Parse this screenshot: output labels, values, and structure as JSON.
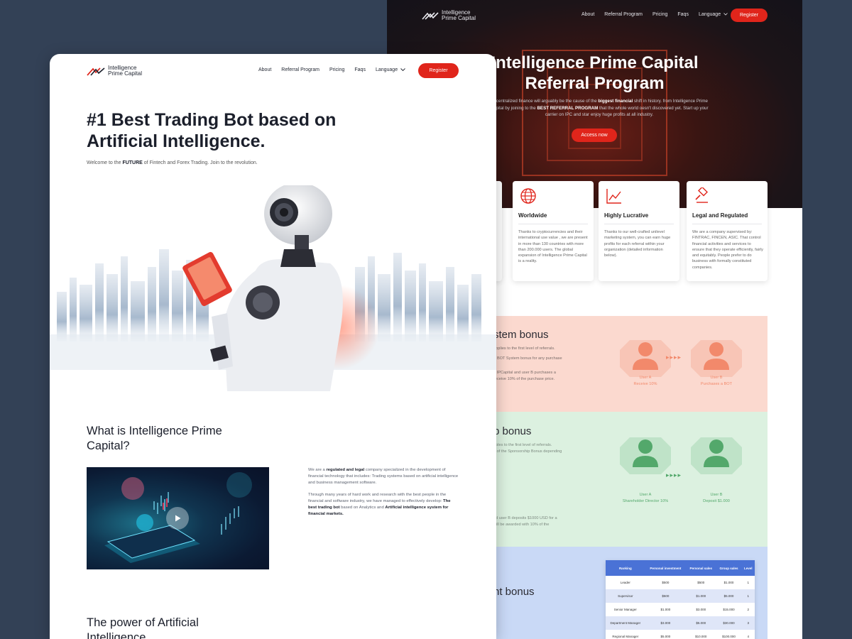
{
  "brand": {
    "line1": "Intelligence",
    "line2": "Prime Capital",
    "accent": "#e0251b"
  },
  "nav": {
    "items": [
      "About",
      "Referral Program",
      "Pricing",
      "Faqs",
      "Language"
    ],
    "register": "Register"
  },
  "referral_page": {
    "title": "Intelligence Prime Capital\nReferral Program",
    "intro_parts": [
      "Decentralized finance will arguably be the cause of the ",
      "biggest financial",
      " shift in history. from Intelligence Prime Capital by joining to the ",
      "BEST REFERRAL PROGRAM",
      " that the whole world oesn't discovered yet. Start up your carrier on IPC and star enjoy huge profits at all industry."
    ],
    "cta": "Access now",
    "cards": [
      {
        "icon": "globe-icon",
        "title": "Worldwide",
        "text": "Thanks to cryptocurrencies and their international use value , we are present in more than 130 countries with more than 200.000 users. The global expansion of Intelligence Prime Capital is a reality."
      },
      {
        "icon": "chart-line-icon",
        "title": "Highly Lucrative",
        "text": "Thanks to our well-crafted unilevel marketing system, you can earn huge profits for each referral within your organization (detailed information below)."
      },
      {
        "icon": "gavel-icon",
        "title": "Legal and Regulated",
        "text": "We are a company supervised by: FINTRAC, FINCEN, ASIC. That control financial activities and services to ensure that they operate efficiently, fairly and equitably. People prefer to do business with formally constituted companies."
      }
    ],
    "system_bonus": {
      "title": "stem bonus",
      "lines": [
        "applies to the first level of referrals.",
        "A BOT System bonus for any purchase",
        "",
        "e IPCapital and user B purchases a",
        "receive 10% of the purchase price."
      ],
      "user_a": [
        "User A",
        "Receive 10%"
      ],
      "user_b": [
        "User B",
        "Purchases a BOT"
      ],
      "color": "#fbd9cf"
    },
    "sponsorship_bonus": {
      "title": "p bonus",
      "lines": [
        "ables to the first level of referrals.",
        "e of the Sponsorship Bonus depending"
      ],
      "lines2": [
        "nd user B deposits $1000 USD for a",
        "will be awarded with 10% of the"
      ],
      "user_a": [
        "User A",
        "Shareholder Director 10%"
      ],
      "user_b": [
        "User B",
        "Deposit $1.000"
      ],
      "color": "#dcf1e0"
    },
    "rank_bonus": {
      "title": "nt bonus",
      "color": "#c9d9f6",
      "table": {
        "headers": [
          "Ranking",
          "Personal investment",
          "Personal sales",
          "Group sales",
          "Level"
        ],
        "rows": [
          [
            "Leader",
            "$500",
            "$500",
            "$1.000",
            "1"
          ],
          [
            "Supervisor",
            "$500",
            "$1.000",
            "$5.000",
            "1"
          ],
          [
            "Senior Manager",
            "$1.000",
            "$3.000",
            "$15.000",
            "2"
          ],
          [
            "Department Manager",
            "$3.000",
            "$5.000",
            "$30.000",
            "3"
          ],
          [
            "Regional Manager",
            "$5.000",
            "$10.000",
            "$100.000",
            "4"
          ]
        ]
      }
    }
  },
  "home_page": {
    "hero_title": "#1 Best Trading Bot based on Artificial Intelligence.",
    "hero_sub_parts": [
      "Welcome to the ",
      "FUTURE",
      " of Fintech and Forex Trading. Join to the revolution."
    ],
    "what_title": "What is Intelligence Prime Capital?",
    "about_p1_parts": [
      "We are a ",
      "regulated and legal",
      " company specialized in the development of financial technology that includes: Trading systems based on artificial intelligence and business management software."
    ],
    "about_p2_parts": [
      "Through many years of hard work and research with the best people in the financial and software industry, we have managed to effectively develop: ",
      "The best trading bot",
      " based on Analytics and ",
      "Artificial intelligence system for financial markets."
    ],
    "power_title": "The power of Artificial Intelligence"
  },
  "icons": {
    "chevron": "chevron-down-icon",
    "play": "play-icon",
    "person": "person-icon"
  },
  "colors": {
    "accent": "#e0251b",
    "page_bg": "#334156",
    "table_header": "#4a72d6",
    "orange": "#f2896b",
    "green": "#53a86b"
  }
}
